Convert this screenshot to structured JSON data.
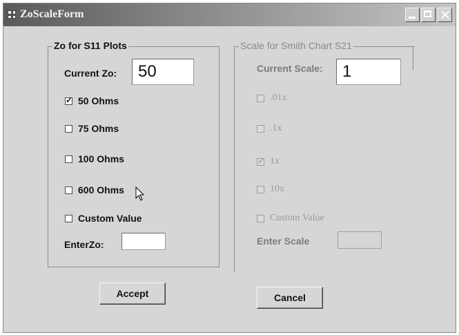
{
  "window": {
    "title": "ZoScaleForm"
  },
  "zo_group": {
    "legend": "Zo for S11 Plots",
    "current_label": "Current Zo:",
    "current_value": "50",
    "options": [
      {
        "label": "50 Ohms",
        "checked": true
      },
      {
        "label": "75 Ohms",
        "checked": false
      },
      {
        "label": "100 Ohms",
        "checked": false
      },
      {
        "label": "600 Ohms",
        "checked": false
      },
      {
        "label": "Custom Value",
        "checked": false
      }
    ],
    "enter_label": "EnterZo:",
    "enter_value": ""
  },
  "scale_group": {
    "legend": "Scale for Smith Chart S21",
    "current_label": "Current Scale:",
    "current_value": "1",
    "options": [
      {
        "label": ".01x",
        "checked": false
      },
      {
        "label": ".1x",
        "checked": false
      },
      {
        "label": "1x",
        "checked": true
      },
      {
        "label": "10x",
        "checked": false
      },
      {
        "label": "Custom Value",
        "checked": false
      }
    ],
    "enter_label": "Enter Scale",
    "enter_value": ""
  },
  "buttons": {
    "accept": "Accept",
    "cancel": "Cancel"
  }
}
